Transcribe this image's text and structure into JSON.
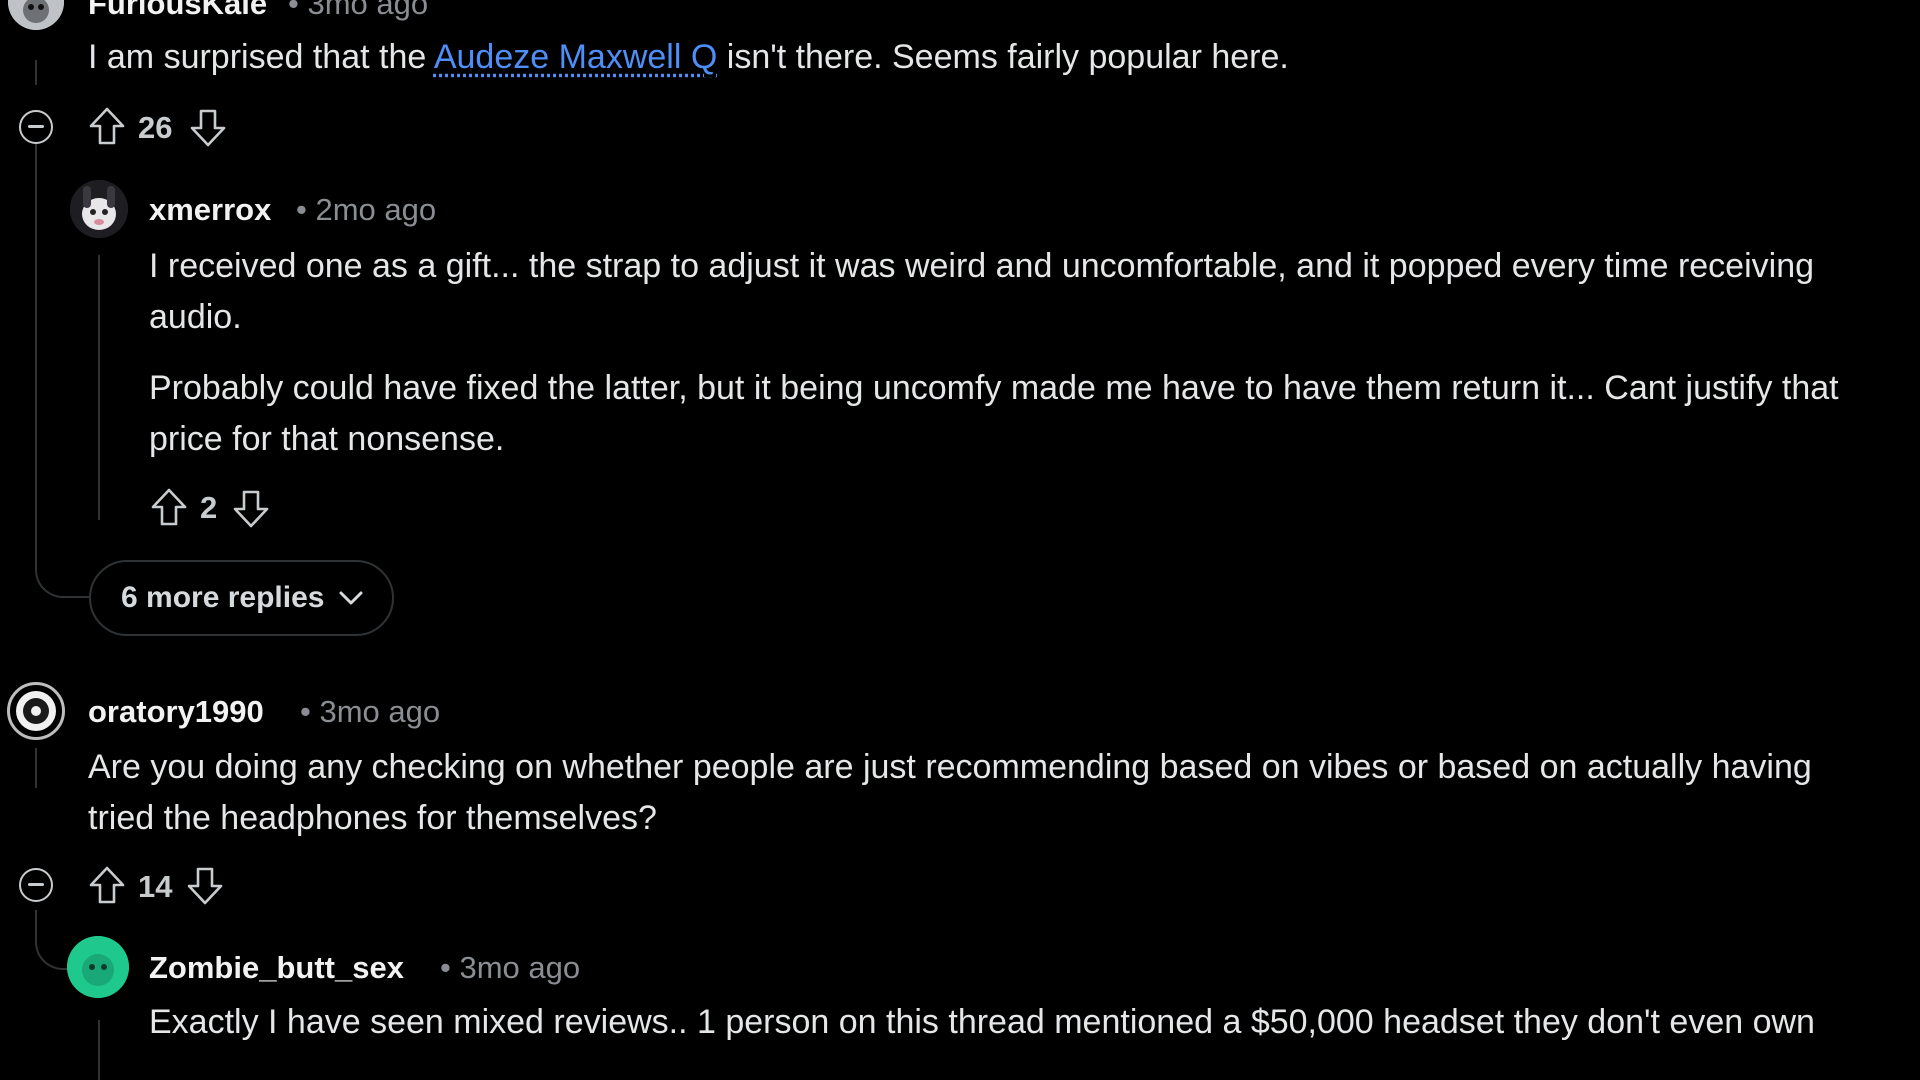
{
  "comments": [
    {
      "author": "FuriousKale",
      "time": "3mo ago",
      "body_before_link": "I am surprised that the ",
      "link_text": "Audeze Maxwell Q",
      "body_after_link": " isn't there. Seems fairly popular here.",
      "votes": "26"
    },
    {
      "author": "xmerrox",
      "time": "2mo ago",
      "paragraphs": [
        "I received one as a gift... the strap to adjust it was weird and uncomfortable, and it popped every time receiving audio.",
        "Probably could have fixed the latter, but it being uncomfy made me have to have them return it... Cant justify that price for that nonsense."
      ],
      "votes": "2"
    },
    {
      "author": "oratory1990",
      "time": "3mo ago",
      "body": "Are you doing any checking on whether people are just recommending based on vibes or based on actually having tried the headphones for themselves?",
      "votes": "14"
    },
    {
      "author": "Zombie_butt_sex",
      "time": "3mo ago",
      "body": "Exactly I have seen mixed reviews.. 1 person on this thread mentioned a $50,000 headset they don't even own"
    }
  ],
  "more_replies_label": "6 more replies",
  "separator": "•",
  "icons": {
    "upvote": "arrow-up-outline-icon",
    "downvote": "arrow-down-outline-icon",
    "collapse": "minus-circle-icon",
    "chevron": "chevron-down-icon"
  },
  "colors": {
    "background": "#000000",
    "link": "#4f8ef7",
    "zombie_avatar": "#1fc98d"
  }
}
